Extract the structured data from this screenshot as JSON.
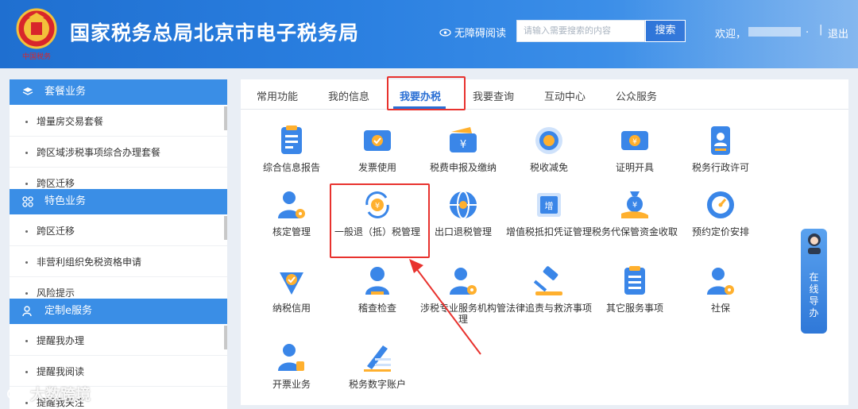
{
  "header": {
    "site_title": "国家税务总局北京市电子税务局",
    "accessible_label": "无障碍阅读",
    "search_placeholder": "请输入需要搜索的内容",
    "search_button": "搜索",
    "welcome": "欢迎，",
    "dot": ".",
    "separator": "|",
    "logout": "退出",
    "emblem_caption": "中国税务"
  },
  "sidebar": {
    "sections": [
      {
        "title": "套餐业务",
        "icon": "layers-icon",
        "items": [
          "增量房交易套餐",
          "跨区域涉税事项综合办理套餐",
          "跨区迁移"
        ]
      },
      {
        "title": "特色业务",
        "icon": "grid-icon",
        "items": [
          "跨区迁移",
          "非营利组织免税资格申请",
          "风险提示"
        ]
      },
      {
        "title": "定制e服务",
        "icon": "user-icon",
        "items": [
          "提醒我办理",
          "提醒我阅读",
          "提醒我关注"
        ]
      }
    ]
  },
  "tabs": [
    "常用功能",
    "我的信息",
    "我要办税",
    "我要查询",
    "互动中心",
    "公众服务"
  ],
  "active_tab": "我要办税",
  "functions": [
    {
      "label": "综合信息报告",
      "icon": "report-icon"
    },
    {
      "label": "发票使用",
      "icon": "invoice-icon"
    },
    {
      "label": "税费申报及缴纳",
      "icon": "wallet-icon"
    },
    {
      "label": "税收减免",
      "icon": "coin-icon"
    },
    {
      "label": "证明开具",
      "icon": "certificate-icon"
    },
    {
      "label": "税务行政许可",
      "icon": "id-card-icon"
    },
    {
      "label": "核定管理",
      "icon": "person-gear-icon"
    },
    {
      "label": "一般退（抵）税管理",
      "icon": "refund-icon"
    },
    {
      "label": "出口退税管理",
      "icon": "globe-icon"
    },
    {
      "label": "增值税抵扣凭证管理",
      "icon": "vat-ticket-icon"
    },
    {
      "label": "税务代保管资金收取",
      "icon": "money-bag-icon"
    },
    {
      "label": "预约定价安排",
      "icon": "gauge-icon"
    },
    {
      "label": "纳税信用",
      "icon": "shield-check-icon"
    },
    {
      "label": "稽查检查",
      "icon": "inspector-icon"
    },
    {
      "label": "涉税专业服务机构管理",
      "icon": "agent-gear-icon"
    },
    {
      "label": "法律追责与救济事项",
      "icon": "gavel-icon"
    },
    {
      "label": "其它服务事项",
      "icon": "clipboard-icon"
    },
    {
      "label": "社保",
      "icon": "social-insurance-icon"
    },
    {
      "label": "开票业务",
      "icon": "invoice-person-icon"
    },
    {
      "label": "税务数字账户",
      "icon": "digital-account-icon"
    }
  ],
  "guide": {
    "label": "在线导办"
  },
  "watermark": "大数跨境",
  "colors": {
    "primary": "#2a6fd4",
    "header": "#1f6fd0",
    "highlight": "#e8322e",
    "sidebar_head": "#3a8ee6"
  }
}
